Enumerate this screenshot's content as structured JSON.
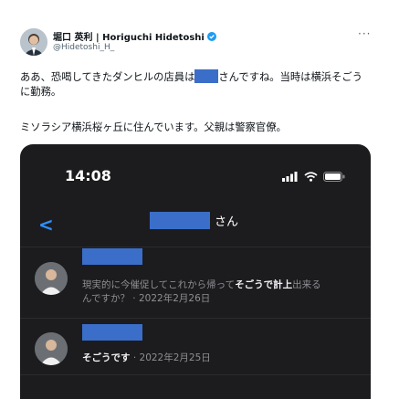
{
  "author": {
    "display_name": "堀口 英利 | Horiguchi Hidetoshi",
    "handle": "@Hidetoshi_H_"
  },
  "menu_label": "···",
  "tweet": {
    "line1_before": "ああ、恐喝してきたダンヒルの店員は",
    "line1_after": "さんですね。当時は横浜そごう",
    "line2": "に勤務。",
    "line3": "ミソラシア横浜桜ヶ丘に住んでいます。父親は警察官僚。"
  },
  "screenshot": {
    "time": "14:08",
    "title_suffix": "さん",
    "messages": [
      {
        "text_before": "現実的に今催促してこれから帰って",
        "text_highlight": "そごうで計上",
        "text_after": "出来る",
        "text_line2": "んですか？ · 2022年2月26日"
      },
      {
        "text_highlight": "そごうです",
        "text_after": " · 2022年2月25日"
      }
    ]
  },
  "colors": {
    "verified": "#1d9bf0",
    "redaction": "#3b6ec8",
    "ios_accent": "#2f8fff",
    "dark_bg": "#1c1c1e"
  }
}
